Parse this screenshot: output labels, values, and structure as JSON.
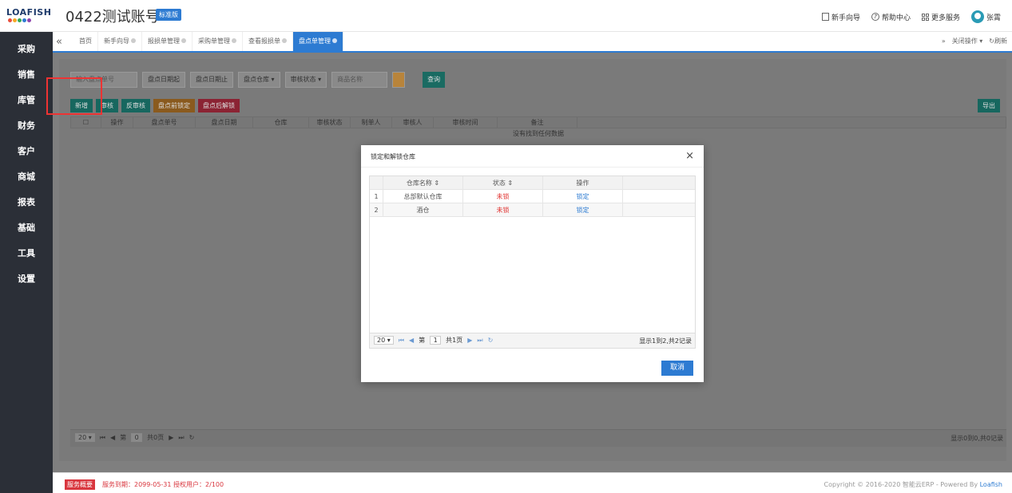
{
  "header": {
    "logo_text": "LOAFISH",
    "account_title": "0422测试账号",
    "edition_badge": "标准版",
    "nav": [
      {
        "label": "新手向导",
        "icon": "guide-icon"
      },
      {
        "label": "帮助中心",
        "icon": "help-icon"
      },
      {
        "label": "更多服务",
        "icon": "grid-icon"
      },
      {
        "label": "张霄",
        "icon": "user-avatar"
      }
    ]
  },
  "sidebar": {
    "items": [
      "采购",
      "销售",
      "库管",
      "财务",
      "客户",
      "商城",
      "报表",
      "基础",
      "工具",
      "设置"
    ]
  },
  "tabs": {
    "items": [
      "首页",
      "新手向导",
      "报损单管理",
      "采购单管理",
      "查看报损单",
      "盘点单管理"
    ],
    "active_index": 5,
    "close_label": "关闭操作",
    "refresh_label": "刷新"
  },
  "filters": {
    "order_no_placeholder": "输入盘点单号",
    "date_start": "盘点日期起",
    "date_end": "盘点日期止",
    "warehouse": "盘点仓库",
    "audit_status": "审核状态",
    "product_name": "商品名称",
    "query_label": "查询"
  },
  "actions": {
    "new": "新增",
    "audit": "审核",
    "unaudit": "反审核",
    "lock_before": "盘点前锁定",
    "unlock_after": "盘点后解锁",
    "export": "导出"
  },
  "grid": {
    "columns": [
      "操作",
      "盘点单号",
      "盘点日期",
      "仓库",
      "审核状态",
      "制单人",
      "审核人",
      "审核时间",
      "备注"
    ],
    "empty_text": "没有找到任何数据",
    "pager": {
      "page_size": "20",
      "page_prefix": "第",
      "page": "0",
      "page_suffix": "共0页",
      "info": "显示0到0,共0记录"
    }
  },
  "modal": {
    "title": "锁定和解锁仓库",
    "columns": [
      "仓库名称",
      "状态",
      "操作"
    ],
    "rows": [
      {
        "idx": "1",
        "name": "总部默认仓库",
        "status": "未锁",
        "action": "锁定"
      },
      {
        "idx": "2",
        "name": "酒仓",
        "status": "未锁",
        "action": "锁定"
      }
    ],
    "pager": {
      "page_size": "20",
      "page_prefix": "第",
      "page": "1",
      "page_suffix": "共1页",
      "info": "显示1到2,共2记录"
    },
    "cancel_label": "取消"
  },
  "footer": {
    "service_badge": "服务概要",
    "service_text": "服务到期：2099-05-31   授权用户：2/100",
    "copyright": "Copyright © 2016-2020 智能云ERP - Powered By ",
    "brand": "Loafish"
  },
  "colors": {
    "primary": "#2d7bd2",
    "danger": "#e0302e",
    "sidebar": "#2b2f37"
  }
}
